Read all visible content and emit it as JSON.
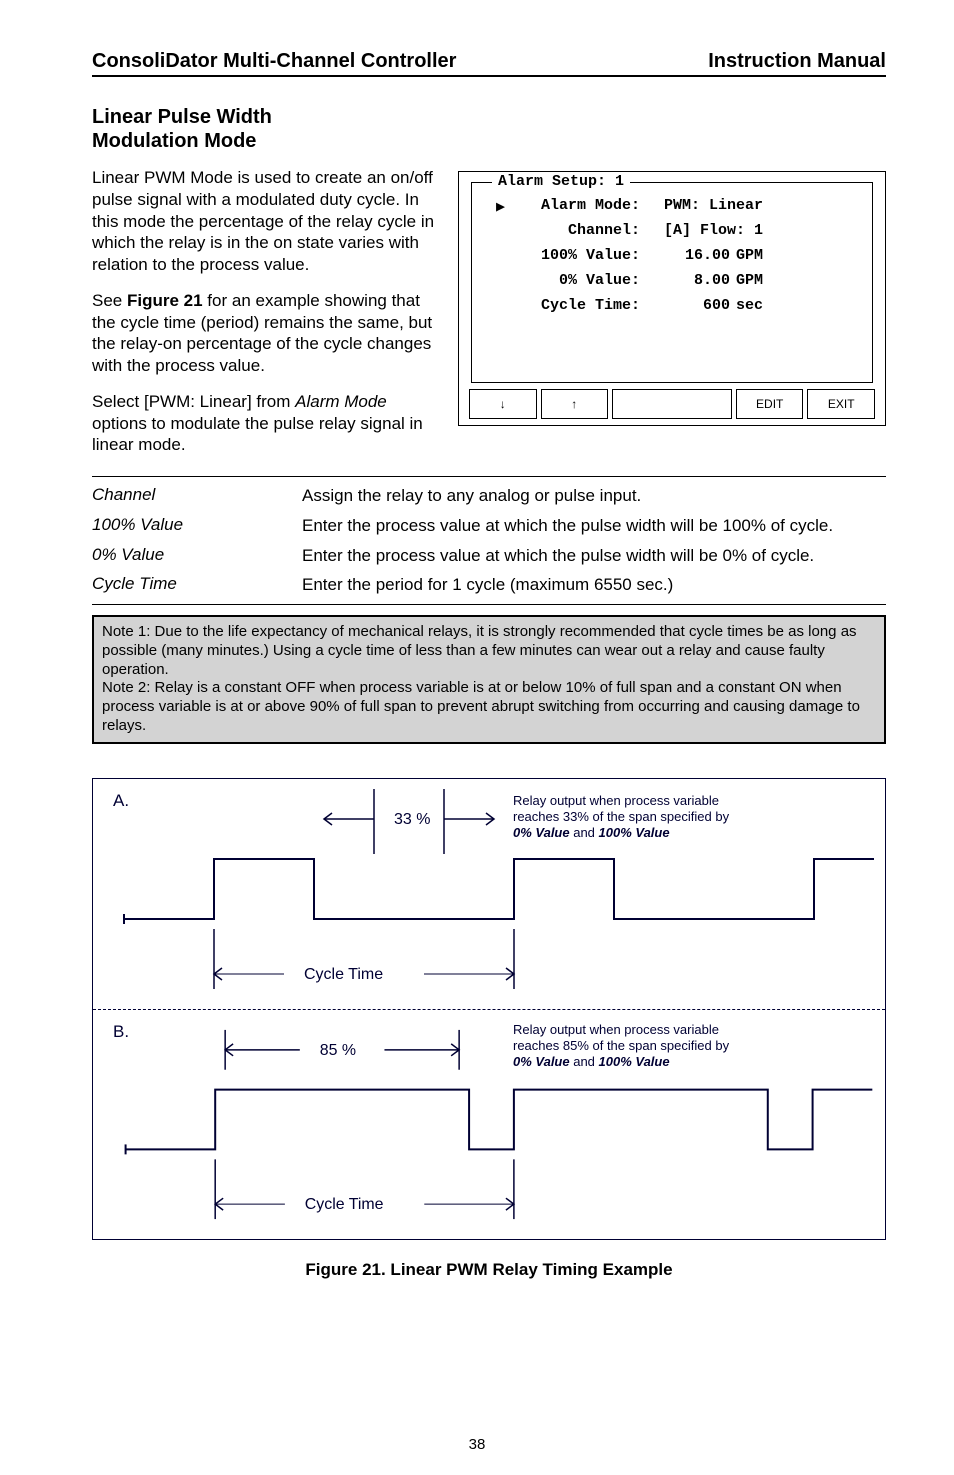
{
  "header": {
    "left": "ConsoliDator Multi-Channel Controller",
    "right": "Instruction Manual"
  },
  "section_title_l1": "Linear Pulse Width",
  "section_title_l2": "Modulation Mode",
  "para1": "Linear PWM Mode is used to create an on/off pulse signal with a modulated duty cycle. In this mode the percentage of the relay cycle in which the relay is in the on state varies with relation to the process value.",
  "para2_a": "See ",
  "para2_b_bold": "Figure 21",
  "para2_c": " for an example showing that the cycle time (period) remains the same, but the relay-on percentage of the cycle changes with the process value.",
  "para3_a": "Select [PWM: Linear] from ",
  "para3_i": "Alarm Mode",
  "para3_b": " options to modulate the pulse relay signal in linear mode.",
  "lcd": {
    "legend": "Alarm Setup: 1",
    "rows": [
      {
        "label": "Alarm Mode:",
        "val": "",
        "valtext": "PWM: Linear",
        "unit": "",
        "ptr": true
      },
      {
        "label": "Channel:",
        "val": "",
        "valtext": "[A] Flow: 1",
        "unit": ""
      },
      {
        "label": "100% Value:",
        "val": "16.00",
        "unit": "GPM"
      },
      {
        "label": "0% Value:",
        "val": "8.00",
        "unit": "GPM"
      },
      {
        "label": "Cycle Time:",
        "val": "600",
        "unit": "sec"
      }
    ],
    "btn_down": "↓",
    "btn_up": "↑",
    "btn_edit": "EDIT",
    "btn_exit": "EXIT"
  },
  "defs": [
    {
      "term": "Channel",
      "body": "Assign the relay to any analog or pulse input."
    },
    {
      "term": "100% Value",
      "body": "Enter the process value at which the pulse width will be 100% of cycle."
    },
    {
      "term": "0% Value",
      "body": "Enter the process value at which the pulse width will be 0% of cycle."
    },
    {
      "term": "Cycle Time",
      "body": "Enter the period for 1 cycle (maximum 6550 sec.)"
    }
  ],
  "note": {
    "n1": "Note 1: Due to the life expectancy of mechanical relays, it is strongly recommended that cycle times be as long as possible (many minutes.) Using a cycle time of less than a few minutes can wear out a relay and cause faulty operation.",
    "n2": "Note 2: Relay is a constant OFF when process variable is at or below 10% of full span and a constant ON when process variable is at or above 90% of full span to prevent abrupt switching from occurring and causing damage to relays."
  },
  "timing": {
    "a_letter": "A.",
    "b_letter": "B.",
    "pct33": "33 %",
    "pct85": "85 %",
    "cycle_label": "Cycle Time",
    "descA_l1": "Relay output  when process variable",
    "descA_l2": "reaches 33% of the span specified by",
    "descA_l3a": "0% Value",
    "descA_l3b": " and ",
    "descA_l3c": "100% Value",
    "descB_l1": "Relay output  when process variable",
    "descB_l2": "reaches 85% of the span specified by",
    "descB_l3a": "0% Value",
    "descB_l3b": " and ",
    "descB_l3c": "100% Value"
  },
  "figure_caption": "Figure 21. Linear PWM Relay Timing Example",
  "page_number": "38",
  "chart_data": [
    {
      "type": "line",
      "title": "Relay output at 33% span (A.)",
      "x": [
        0,
        0,
        1,
        1,
        3,
        3,
        4,
        4,
        6
      ],
      "values": [
        0,
        1,
        1,
        0,
        0,
        1,
        1,
        0,
        0
      ],
      "cycle_time_units": 3,
      "duty_percent": 33
    },
    {
      "type": "line",
      "title": "Relay output at 85% span (B.)",
      "x": [
        0,
        0,
        2.55,
        2.55,
        3,
        3,
        5.55,
        5.55,
        6
      ],
      "values": [
        0,
        1,
        1,
        0,
        0,
        1,
        1,
        0,
        0
      ],
      "cycle_time_units": 3,
      "duty_percent": 85
    }
  ]
}
